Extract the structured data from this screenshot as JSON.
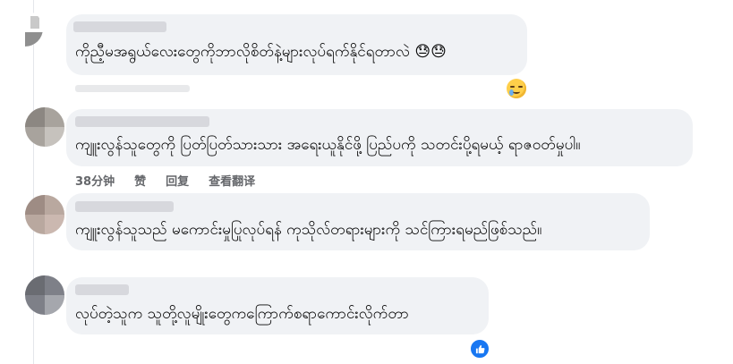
{
  "comments": [
    {
      "text": "ကိုညီ့မအရွယ်လေးတွေကိုဘာလိုစိတ်နဲ့များလုပ်ရက်နိုင်ရတာလဲ 😓😓",
      "emoji": "downcast-sweat-face"
    },
    {
      "text": "ကျူးလွန်သူတွေကို ပြတ်ပြတ်သားသား အရေးယူနိုင်ဖို့ ပြည်ပကို သတင်းပို့ရမယ့် ရာဇဝတ်မှုပါ။",
      "actions": {
        "time": "38分钟",
        "like": "赞",
        "reply": "回复",
        "translate": "查看翻译"
      }
    },
    {
      "text": "ကျူးလွန်သူသည် မကောင်းမှုပြုလုပ်ရန် ကုသိုလ်တရားများကို သင်ကြားရမည်ဖြစ်သည်။"
    },
    {
      "text": "လုပ်တဲ့သူက သူတို့လူမျိုးတွေကကြောက်စရာကောင်းလိုက်တာ",
      "reaction": "like-icon"
    }
  ],
  "reaction_emoji": "crying-face",
  "colors": {
    "bubble": "#f0f2f5",
    "action_text": "#65676b",
    "like_blue": "#1877f2"
  }
}
